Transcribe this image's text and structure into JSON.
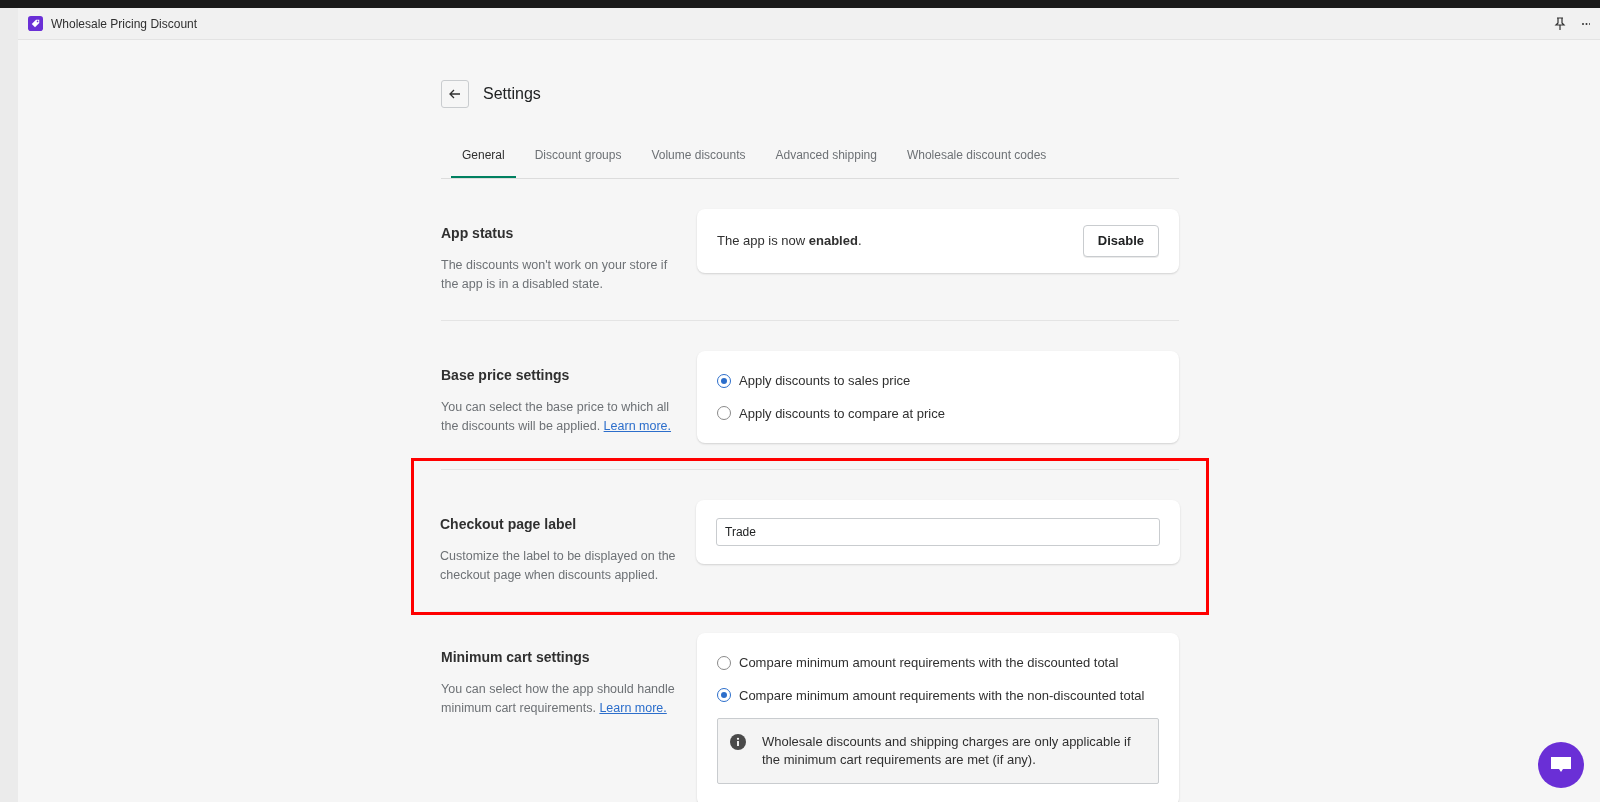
{
  "app_bar": {
    "title": "Wholesale Pricing Discount"
  },
  "page": {
    "title": "Settings"
  },
  "tabs": [
    {
      "label": "General",
      "selected": true
    },
    {
      "label": "Discount groups",
      "selected": false
    },
    {
      "label": "Volume discounts",
      "selected": false
    },
    {
      "label": "Advanced shipping",
      "selected": false
    },
    {
      "label": "Wholesale discount codes",
      "selected": false
    }
  ],
  "sections": [
    {
      "kind": "status",
      "title": "App status",
      "description": "The discounts won't work on your store if the app is in a disabled state.",
      "highlighted": false,
      "status_text": "The app is now **enabled**.",
      "button": "Disable"
    },
    {
      "kind": "radio",
      "title": "Base price settings",
      "description": "You can select the base price to which all the discounts will be applied.",
      "link": "Learn more.",
      "highlighted": false,
      "options": [
        {
          "label": "Apply discounts to sales price",
          "selected": true
        },
        {
          "label": "Apply discounts to compare at price",
          "selected": false
        }
      ]
    },
    {
      "kind": "text",
      "title": "Checkout page label",
      "description": "Customize the label to be displayed on the checkout page when discounts applied.",
      "highlighted": true,
      "value": "Trade"
    },
    {
      "kind": "radio",
      "title": "Minimum cart settings",
      "description": "You can select how the app should handle minimum cart requirements.",
      "link": "Learn more.",
      "highlighted": false,
      "options": [
        {
          "label": "Compare minimum amount requirements with the discounted total",
          "selected": false
        },
        {
          "label": "Compare minimum amount requirements with the non-discounted total",
          "selected": true
        }
      ],
      "note": "Wholesale discounts and shipping charges are only applicable if the minimum cart requirements are met (if any)."
    }
  ]
}
